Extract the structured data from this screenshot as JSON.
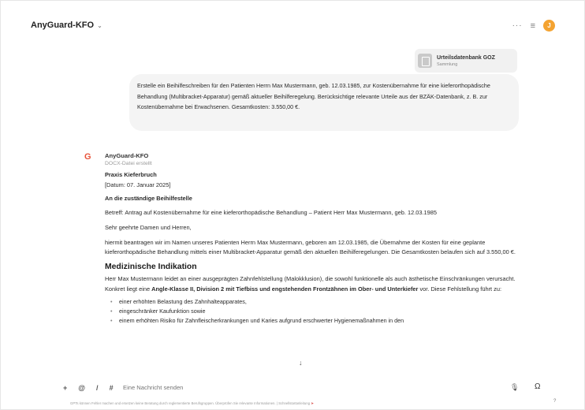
{
  "header": {
    "title": "AnyGuard-KFO",
    "more_icon": "more-horizontal-icon",
    "settings_icon": "sliders-icon",
    "avatar_text": "J",
    "avatar_color": "#f4a331"
  },
  "attachment": {
    "title": "Urteilsdatenbank GOZ",
    "subtitle": "Sammlung"
  },
  "user_message": {
    "text": "Erstelle ein Beihilfeschreiben für den Patienten Herrn Max Mustermann, geb. 12.03.1985, zur Kostenübernahme für eine kieferorthopädische Behandlung (Multibracket-Apparatur) gemäß aktueller Beihilferegelung. Berücksichtige relevante Urteile aus der BZÄK-Datenbank, z. B. zur Kostenübernahme bei Erwachsenen. Gesamtkosten: 3.550,00 €."
  },
  "assistant": {
    "name": "AnyGuard-KFO",
    "status": "DOCX-Datei erstellt",
    "practice": "Praxis Kieferbruch",
    "date": "[Datum: 07. Januar 2025]",
    "recipient": "An die zuständige Beihilfestelle",
    "subject": "Betreff: Antrag auf Kostenübernahme für eine kieferorthopädische Behandlung – Patient Herr Max Mustermann, geb. 12.03.1985",
    "salutation": "Sehr geehrte Damen und Herren,",
    "paragraph1": "hiermit beantragen wir im Namen unseres Patienten Herrn Max Mustermann, geboren am 12.03.1985, die Übernahme der Kosten für eine geplante kieferorthopädische Behandlung mittels einer Multibracket-Apparatur gemäß den aktuellen Beihilferegelungen. Die Gesamtkosten belaufen sich auf 3.550,00 €.",
    "heading": "Medizinische Indikation",
    "paragraph2_a": "Herr Max Mustermann leidet an einer ausgeprägten Zahnfehlstellung (Malokklusion), die sowohl funktionelle als auch ästhetische Einschränkungen verursacht. Konkret liegt eine ",
    "paragraph2_bold": "Angle-Klasse II, Division 2 mit Tiefbiss und engstehenden Frontzähnen im Ober- und Unterkiefer",
    "paragraph2_b": " vor. Diese Fehlstellung führt zu:",
    "bullets": [
      "einer erhöhten Belastung des Zahnhalteapparates,",
      "eingeschränker Kaufunktion sowie",
      "einem erhöhten Risiko für Zahnfleischerkrankungen und Karies aufgrund erschwerter Hygienemaßnahmen in den"
    ]
  },
  "composer": {
    "placeholder": "Eine Nachricht senden",
    "tools": [
      "+",
      "@",
      "/",
      "#"
    ]
  },
  "footer": {
    "text": "GPTs können Fehler machen und ersetzen keine Beratung durch reglementierte Berufsgruppen. Überprüfen Sie relevante Informationen. | Schnellstartanleitung",
    "help": "?"
  }
}
